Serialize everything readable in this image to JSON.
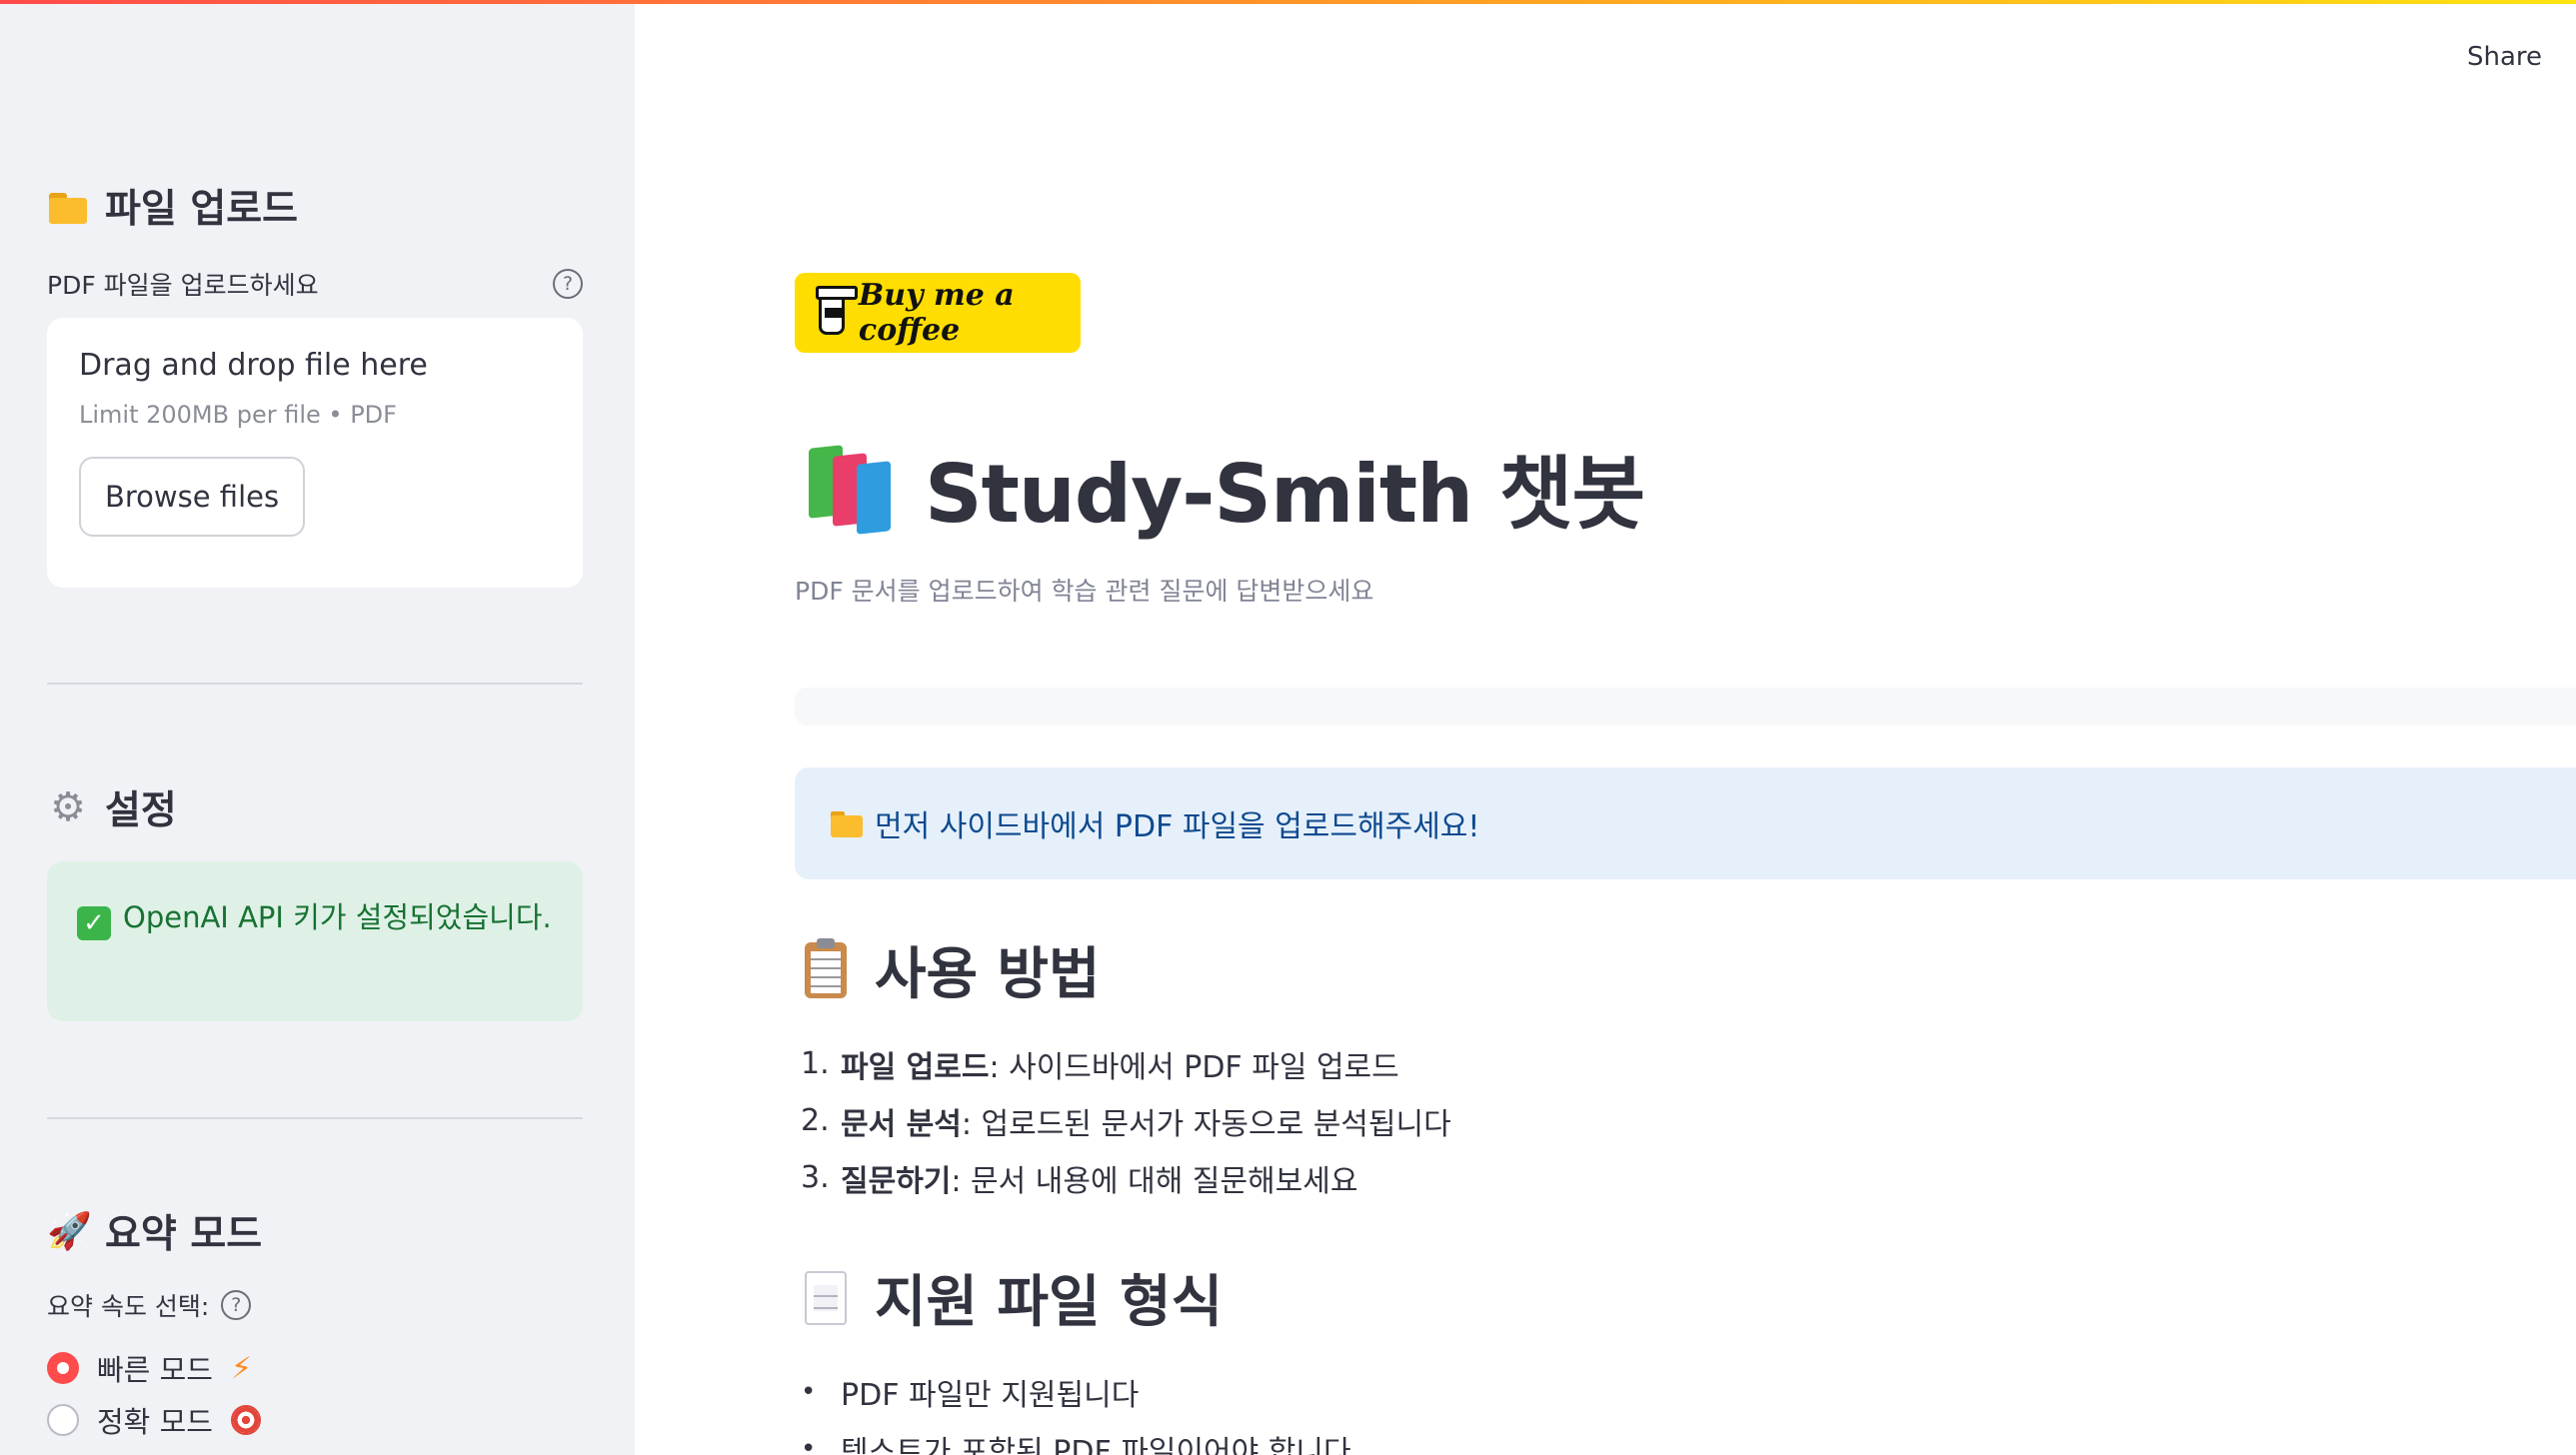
{
  "sidebar": {
    "upload_section": {
      "title": "파일 업로드",
      "icon": "folder-icon",
      "label": "PDF 파일을 업로드하세요",
      "help": "?",
      "dropzone_title": "Drag and drop file here",
      "dropzone_limit": "Limit 200MB per file • PDF",
      "browse_label": "Browse files"
    },
    "settings_section": {
      "title": "설정",
      "icon": "gear-icon",
      "success_message": "OpenAI API 키가 설정되었습니다."
    },
    "summary_section": {
      "title": "요약 모드",
      "icon": "rocket-icon",
      "label": "요약 속도 선택:",
      "help": "?",
      "options": [
        {
          "label": "빠른 모드",
          "icon": "lightning-icon",
          "selected": true
        },
        {
          "label": "정확 모드",
          "icon": "target-icon",
          "selected": false
        }
      ]
    }
  },
  "header": {
    "share_label": "Share"
  },
  "main": {
    "coffee_label": "Buy me a coffee",
    "title": "Study-Smith 챗봇",
    "title_icon": "books-icon",
    "subtitle": "PDF 문서를 업로드하여 학습 관련 질문에 답변받으세요",
    "info_message": "먼저 사이드바에서 PDF 파일을 업로드해주세요!",
    "howto": {
      "title": "사용 방법",
      "icon": "clipboard-icon",
      "steps": [
        {
          "num": "1.",
          "bold": "파일 업로드",
          "text": ": 사이드바에서 PDF 파일 업로드"
        },
        {
          "num": "2.",
          "bold": "문서 분석",
          "text": ": 업로드된 문서가 자동으로 분석됩니다"
        },
        {
          "num": "3.",
          "bold": "질문하기",
          "text": ": 문서 내용에 대해 질문해보세요"
        }
      ]
    },
    "formats": {
      "title": "지원 파일 형식",
      "icon": "document-icon",
      "items": [
        "PDF 파일만 지원됩니다",
        "텍스트가 포함된 PDF 파일이어야 합니다"
      ]
    }
  },
  "colors": {
    "accent": "#ff4b4b",
    "sidebar_bg": "#f0f2f6",
    "success_bg": "#dff1e6",
    "info_bg": "#e6f0fb",
    "coffee_bg": "#ffdd00"
  }
}
